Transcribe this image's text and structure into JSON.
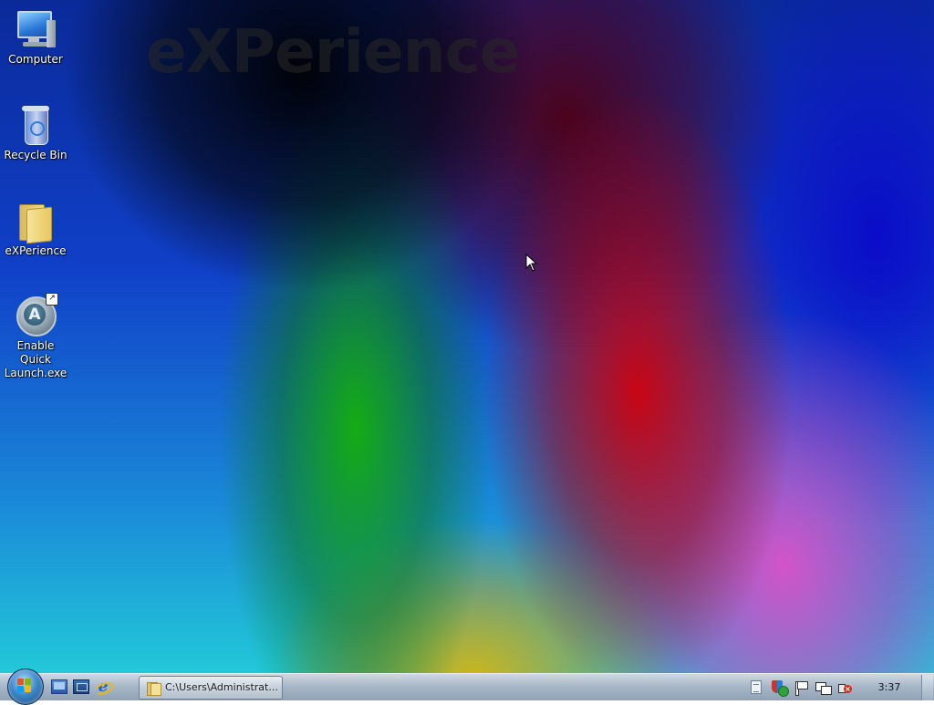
{
  "desktop": {
    "watermark_text": "eXPerience",
    "icons": [
      {
        "label": "Computer",
        "icon": "computer-icon"
      },
      {
        "label": "Recycle Bin",
        "icon": "recycle-bin-icon"
      },
      {
        "label": "eXPerience",
        "icon": "folder-icon"
      },
      {
        "label_line1": "Enable Quick",
        "label_line2": "Launch.exe",
        "icon": "quick-launch-app-icon"
      }
    ]
  },
  "taskbar": {
    "start_button_icon": "start-orb-icon",
    "quick_launch": [
      {
        "icon": "show-desktop-icon"
      },
      {
        "icon": "switch-windows-icon"
      },
      {
        "icon": "internet-explorer-icon"
      }
    ],
    "task_buttons": [
      {
        "label": "C:\\Users\\Administrat...",
        "icon": "folder-icon"
      }
    ],
    "tray_icons": [
      "document-icon",
      "security-center-icon",
      "action-center-flag-icon",
      "network-icon",
      "volume-muted-icon"
    ],
    "clock": "3:37"
  }
}
